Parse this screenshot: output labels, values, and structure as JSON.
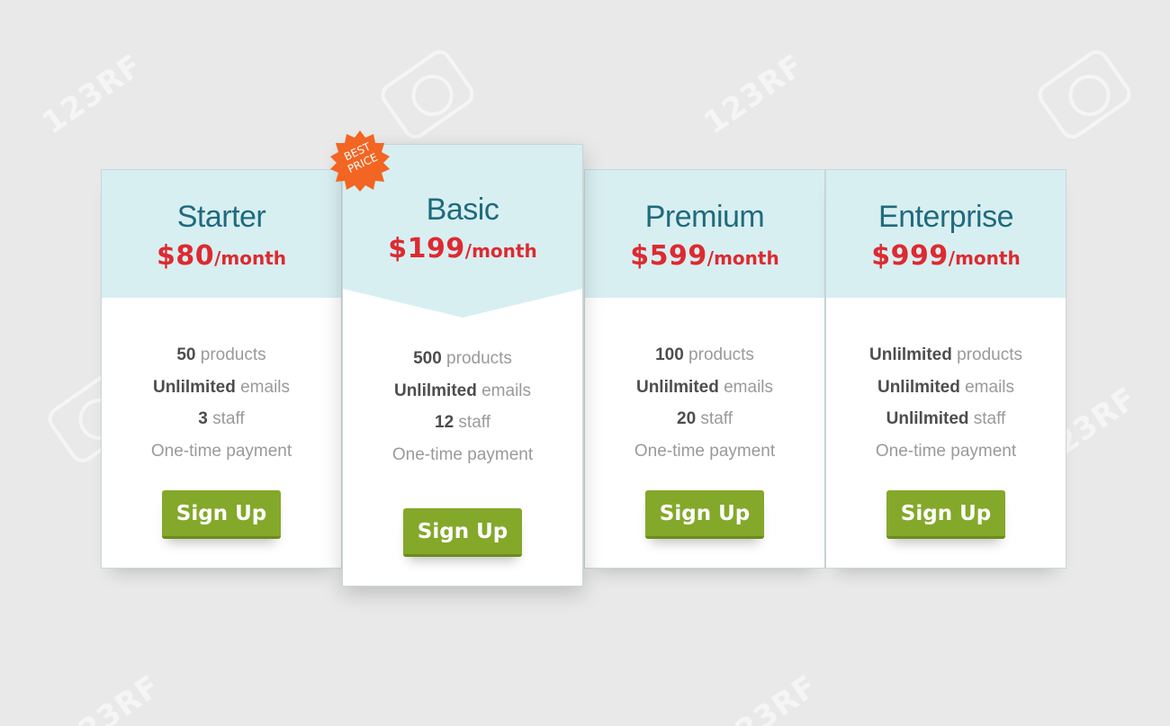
{
  "accent_colors": {
    "header_bg": "#d8eff2",
    "plan_name": "#1f6b7d",
    "price": "#dd2a30",
    "button": "#84a82a",
    "badge": "#f26522"
  },
  "badge": {
    "text": "BEST PRICE",
    "line1": "Best",
    "line2": "Price"
  },
  "plans": [
    {
      "name": "Starter",
      "amount": "$80",
      "period": "/month",
      "features": [
        {
          "strong": "50",
          "rest": " products"
        },
        {
          "strong": "Unlilmited",
          "rest": " emails"
        },
        {
          "strong": "3",
          "rest": " staff"
        },
        {
          "strong": "",
          "rest": "One-time payment"
        }
      ],
      "button": "Sign Up"
    },
    {
      "name": "Basic",
      "amount": "$199",
      "period": "/month",
      "features": [
        {
          "strong": "500",
          "rest": " products"
        },
        {
          "strong": "Unlilmited",
          "rest": " emails"
        },
        {
          "strong": "12",
          "rest": " staff"
        },
        {
          "strong": "",
          "rest": "One-time payment"
        }
      ],
      "button": "Sign Up"
    },
    {
      "name": "Premium",
      "amount": "$599",
      "period": "/month",
      "features": [
        {
          "strong": "100",
          "rest": " products"
        },
        {
          "strong": "Unlilmited",
          "rest": " emails"
        },
        {
          "strong": "20",
          "rest": " staff"
        },
        {
          "strong": "",
          "rest": "One-time payment"
        }
      ],
      "button": "Sign Up"
    },
    {
      "name": "Enterprise",
      "amount": "$999",
      "period": "/month",
      "features": [
        {
          "strong": "Unlilmited",
          "rest": " products"
        },
        {
          "strong": "Unlilmited",
          "rest": " emails"
        },
        {
          "strong": "Unlilmited",
          "rest": " staff"
        },
        {
          "strong": "",
          "rest": "One-time payment"
        }
      ],
      "button": "Sign Up"
    }
  ],
  "watermark": "123RF"
}
